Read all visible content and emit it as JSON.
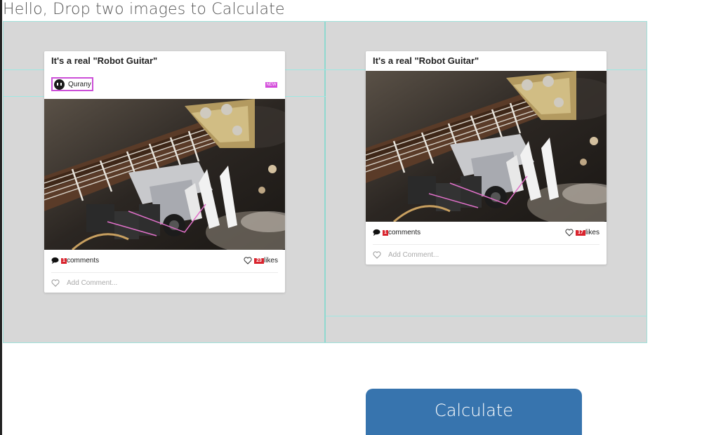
{
  "heading": "Hello, Drop two images to Calculate",
  "cards": [
    {
      "title": "It's a real \"Robot Guitar\"",
      "author": "Qurany",
      "author_badge": "NEW",
      "comments_count": "1",
      "comments_label": "comments",
      "likes_count": "23",
      "likes_label": "likes",
      "add_comment_placeholder": "Add Comment..."
    },
    {
      "title": "It's a real \"Robot Guitar\"",
      "comments_count": "1",
      "comments_label": "comments",
      "likes_count": "17",
      "likes_label": "likes",
      "add_comment_placeholder": "Add Comment..."
    }
  ],
  "calculate_button": "Calculate",
  "colors": {
    "accent_button": "#3774ae",
    "highlight": "#cc4fd8",
    "count_badge": "#d9232d",
    "guide": "#9fe8e3",
    "panel_bg": "#d7d7d7"
  },
  "icons": [
    "comment-bubble-icon",
    "heart-icon",
    "avatar-icon"
  ]
}
